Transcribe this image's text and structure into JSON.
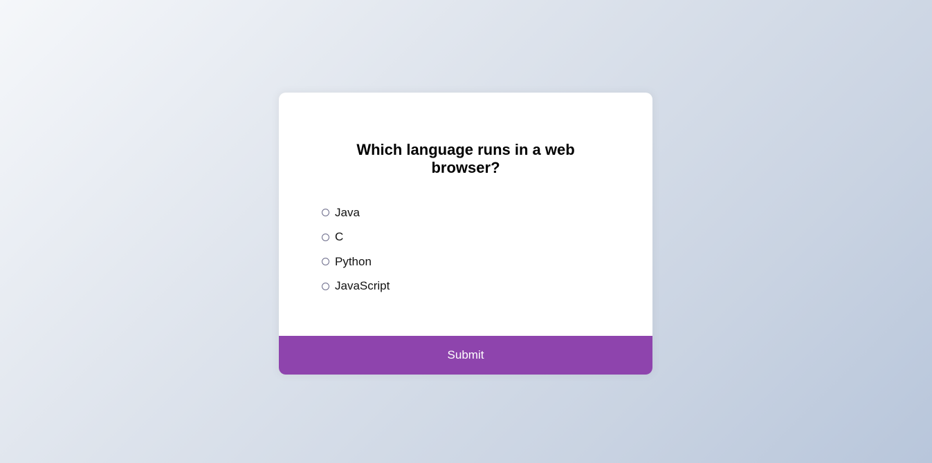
{
  "quiz": {
    "question": "Which language runs in a web browser?",
    "answers": [
      {
        "label": "Java"
      },
      {
        "label": "C"
      },
      {
        "label": "Python"
      },
      {
        "label": "JavaScript"
      }
    ],
    "submit_label": "Submit"
  },
  "colors": {
    "accent": "#8e44ad",
    "card_background": "#ffffff"
  }
}
